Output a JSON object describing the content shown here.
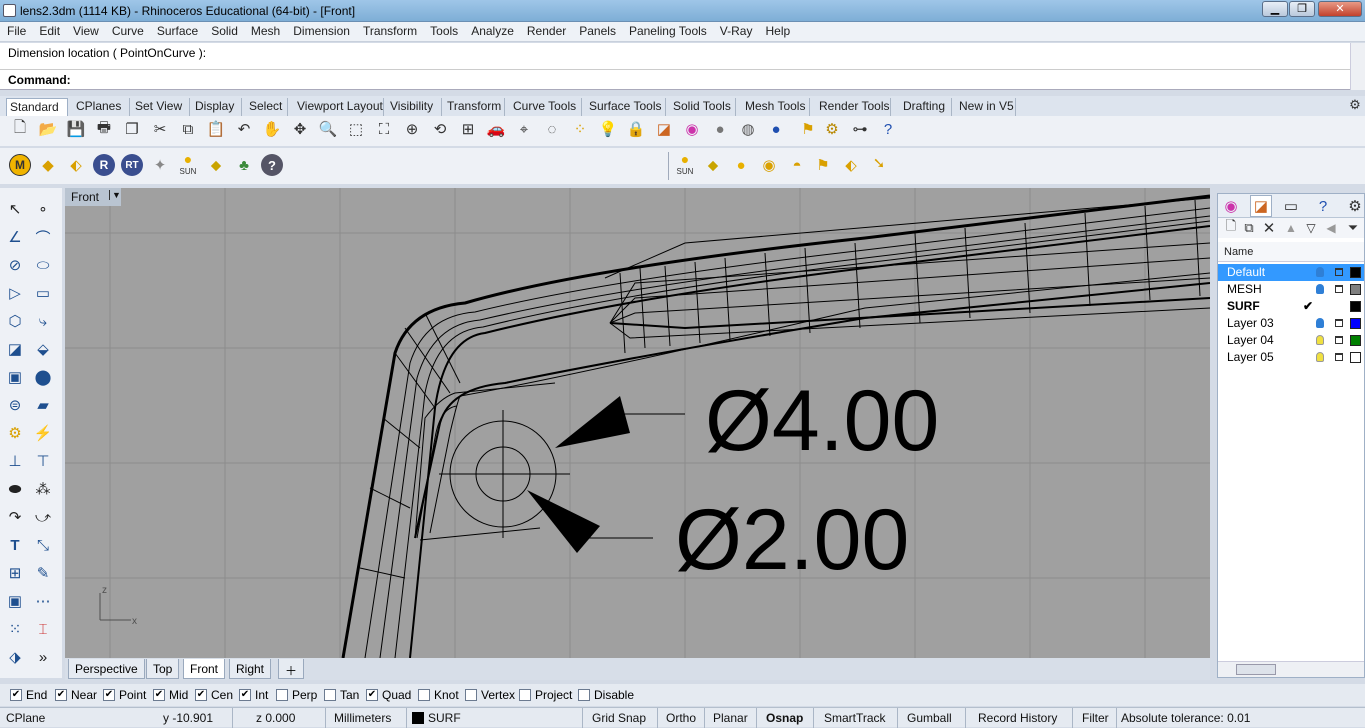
{
  "window": {
    "title": "lens2.3dm (1114 KB) - Rhinoceros Educational (64-bit) - [Front]",
    "min": "▁",
    "max": "❐",
    "close": "✕"
  },
  "menu": [
    "File",
    "Edit",
    "View",
    "Curve",
    "Surface",
    "Solid",
    "Mesh",
    "Dimension",
    "Transform",
    "Tools",
    "Analyze",
    "Render",
    "Panels",
    "Paneling Tools",
    "V-Ray",
    "Help"
  ],
  "command": {
    "history": "Dimension location ( PointOnCurve ):",
    "prompt": "Command:"
  },
  "tabs": [
    "Standard",
    "CPlanes",
    "Set View",
    "Display",
    "Select",
    "Viewport Layout",
    "Visibility",
    "Transform",
    "Curve Tools",
    "Surface Tools",
    "Solid Tools",
    "Mesh Tools",
    "Render Tools",
    "Drafting",
    "New in V5"
  ],
  "toolbar2_labels": {
    "m": "M",
    "r": "R",
    "rt": "RT",
    "sun": "SUN",
    "help": "?"
  },
  "viewport": {
    "name": "Front",
    "dim1": "Ø4.00",
    "dim2": "Ø2.00",
    "axis_z": "z",
    "axis_x": "x"
  },
  "viewport_tabs": [
    "Perspective",
    "Top",
    "Front",
    "Right"
  ],
  "layers": {
    "header": "Name",
    "rows": [
      {
        "name": "Default",
        "color": "#000000",
        "bulb": "#2f7fd6"
      },
      {
        "name": "MESH",
        "color": "#808080",
        "bulb": "#2f7fd6"
      },
      {
        "name": "SURF",
        "color": "#000000",
        "current": "✔"
      },
      {
        "name": "Layer 03",
        "color": "#0000ff",
        "bulb": "#2f7fd6"
      },
      {
        "name": "Layer 04",
        "color": "#008000",
        "bulb": "#f0e040"
      },
      {
        "name": "Layer 05",
        "color": "#ffffff",
        "bulb": "#f0e040"
      }
    ]
  },
  "osnaps": [
    {
      "label": "End",
      "checked": true
    },
    {
      "label": "Near",
      "checked": true
    },
    {
      "label": "Point",
      "checked": true
    },
    {
      "label": "Mid",
      "checked": true
    },
    {
      "label": "Cen",
      "checked": true
    },
    {
      "label": "Int",
      "checked": true
    },
    {
      "label": "Perp",
      "checked": false
    },
    {
      "label": "Tan",
      "checked": false
    },
    {
      "label": "Quad",
      "checked": true
    },
    {
      "label": "Knot",
      "checked": false
    },
    {
      "label": "Vertex",
      "checked": false
    },
    {
      "label": "Project",
      "checked": false
    },
    {
      "label": "Disable",
      "checked": false
    }
  ],
  "status": {
    "cplane": "CPlane",
    "y": "y -10.901",
    "z": "z 0.000",
    "units": "Millimeters",
    "layer": "SURF",
    "grid": "Grid Snap",
    "ortho": "Ortho",
    "planar": "Planar",
    "osnap": "Osnap",
    "smart": "SmartTrack",
    "gumball": "Gumball",
    "history": "Record History",
    "filter": "Filter",
    "tol": "Absolute tolerance: 0.01"
  }
}
